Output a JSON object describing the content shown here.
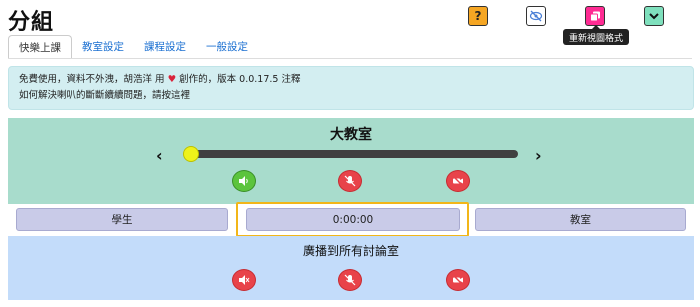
{
  "header": {
    "title": "分組",
    "help_label": "?",
    "tooltip": "重新視圖格式"
  },
  "icons": {
    "help": "question-icon",
    "eye": "eye-slash-icon",
    "reset": "copy-icon",
    "collapse": "chevron-down-icon"
  },
  "tabs": [
    {
      "label": "快樂上課",
      "active": true
    },
    {
      "label": "教室設定",
      "active": false
    },
    {
      "label": "課程設定",
      "active": false
    },
    {
      "label": "一般設定",
      "active": false
    }
  ],
  "notice": {
    "line1_prefix": "免費使用，資料不外洩，胡浩洋 用",
    "line1_suffix": "創作的，版本 0.0.17.5 注釋",
    "line2": "如何解決喇叭的斷斷續續問題，請按這裡"
  },
  "classroom": {
    "title": "大教室",
    "prev": "‹",
    "next": "›",
    "slider_level": 0
  },
  "middle": {
    "left_label": "學生",
    "timer": "0:00:00",
    "right_label": "教室"
  },
  "broadcast": {
    "title": "廣播到所有討論室"
  },
  "colors": {
    "classroom_bg": "#a8dccc",
    "broadcast_bg": "#c3dcfa",
    "notice_bg": "#d3eef1",
    "accent_link": "#1a6fd1",
    "help_btn": "#f5a623",
    "reset_btn": "#ff2b93",
    "collapse_btn": "#7fe0bd",
    "timer_outline": "#f2b619"
  }
}
